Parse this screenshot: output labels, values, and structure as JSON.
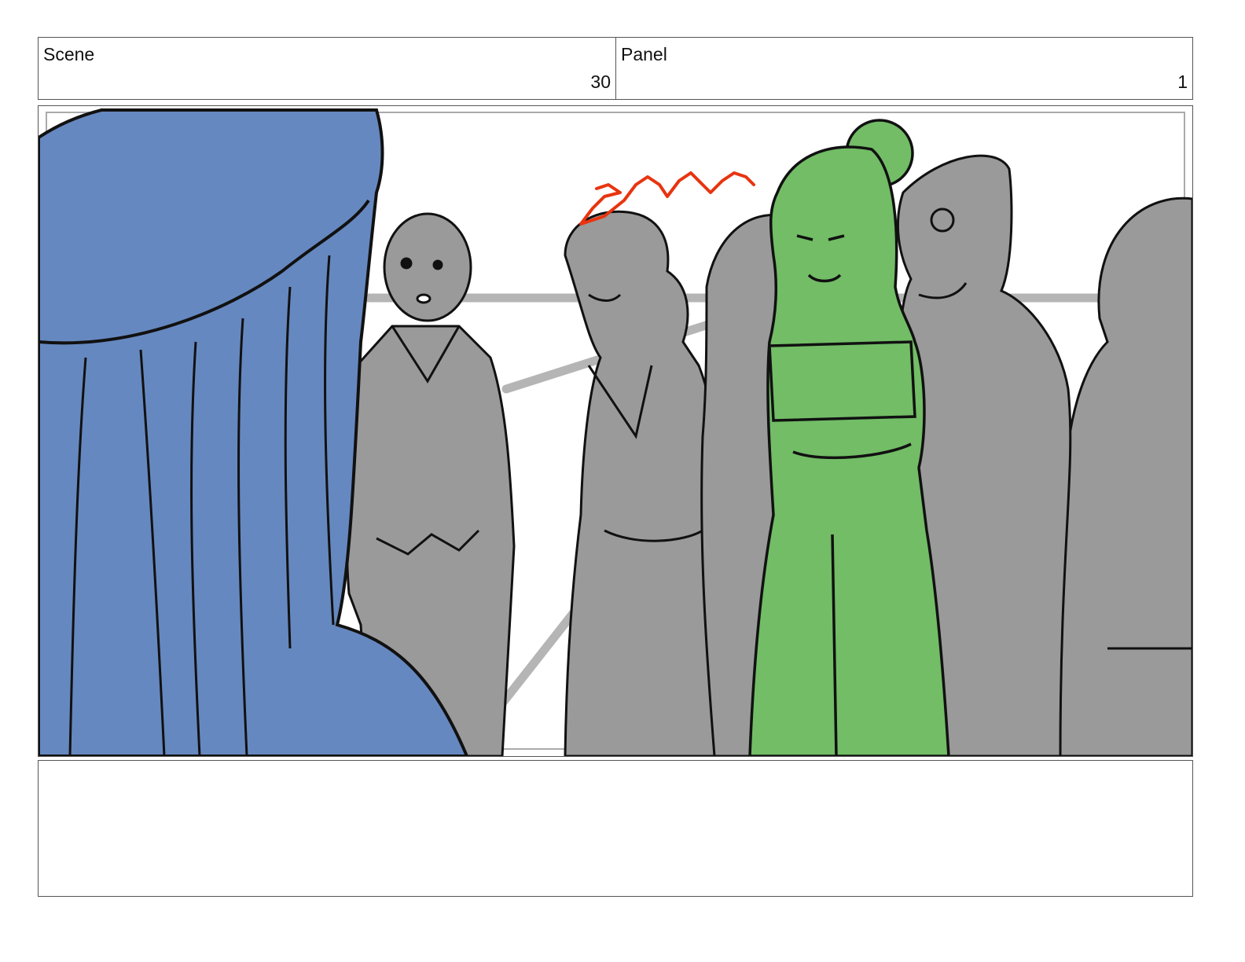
{
  "header": {
    "scene_label": "Scene",
    "scene_value": "30",
    "panel_label": "Panel",
    "panel_value": "1"
  },
  "notes": {
    "text": ""
  },
  "colors": {
    "blue_character": "#6688c0",
    "green_character": "#72bd66",
    "crowd_gray": "#9a9a9a",
    "background_lines": "#b5b5b5",
    "accent_scribble": "#e8340f",
    "outline": "#111111"
  }
}
